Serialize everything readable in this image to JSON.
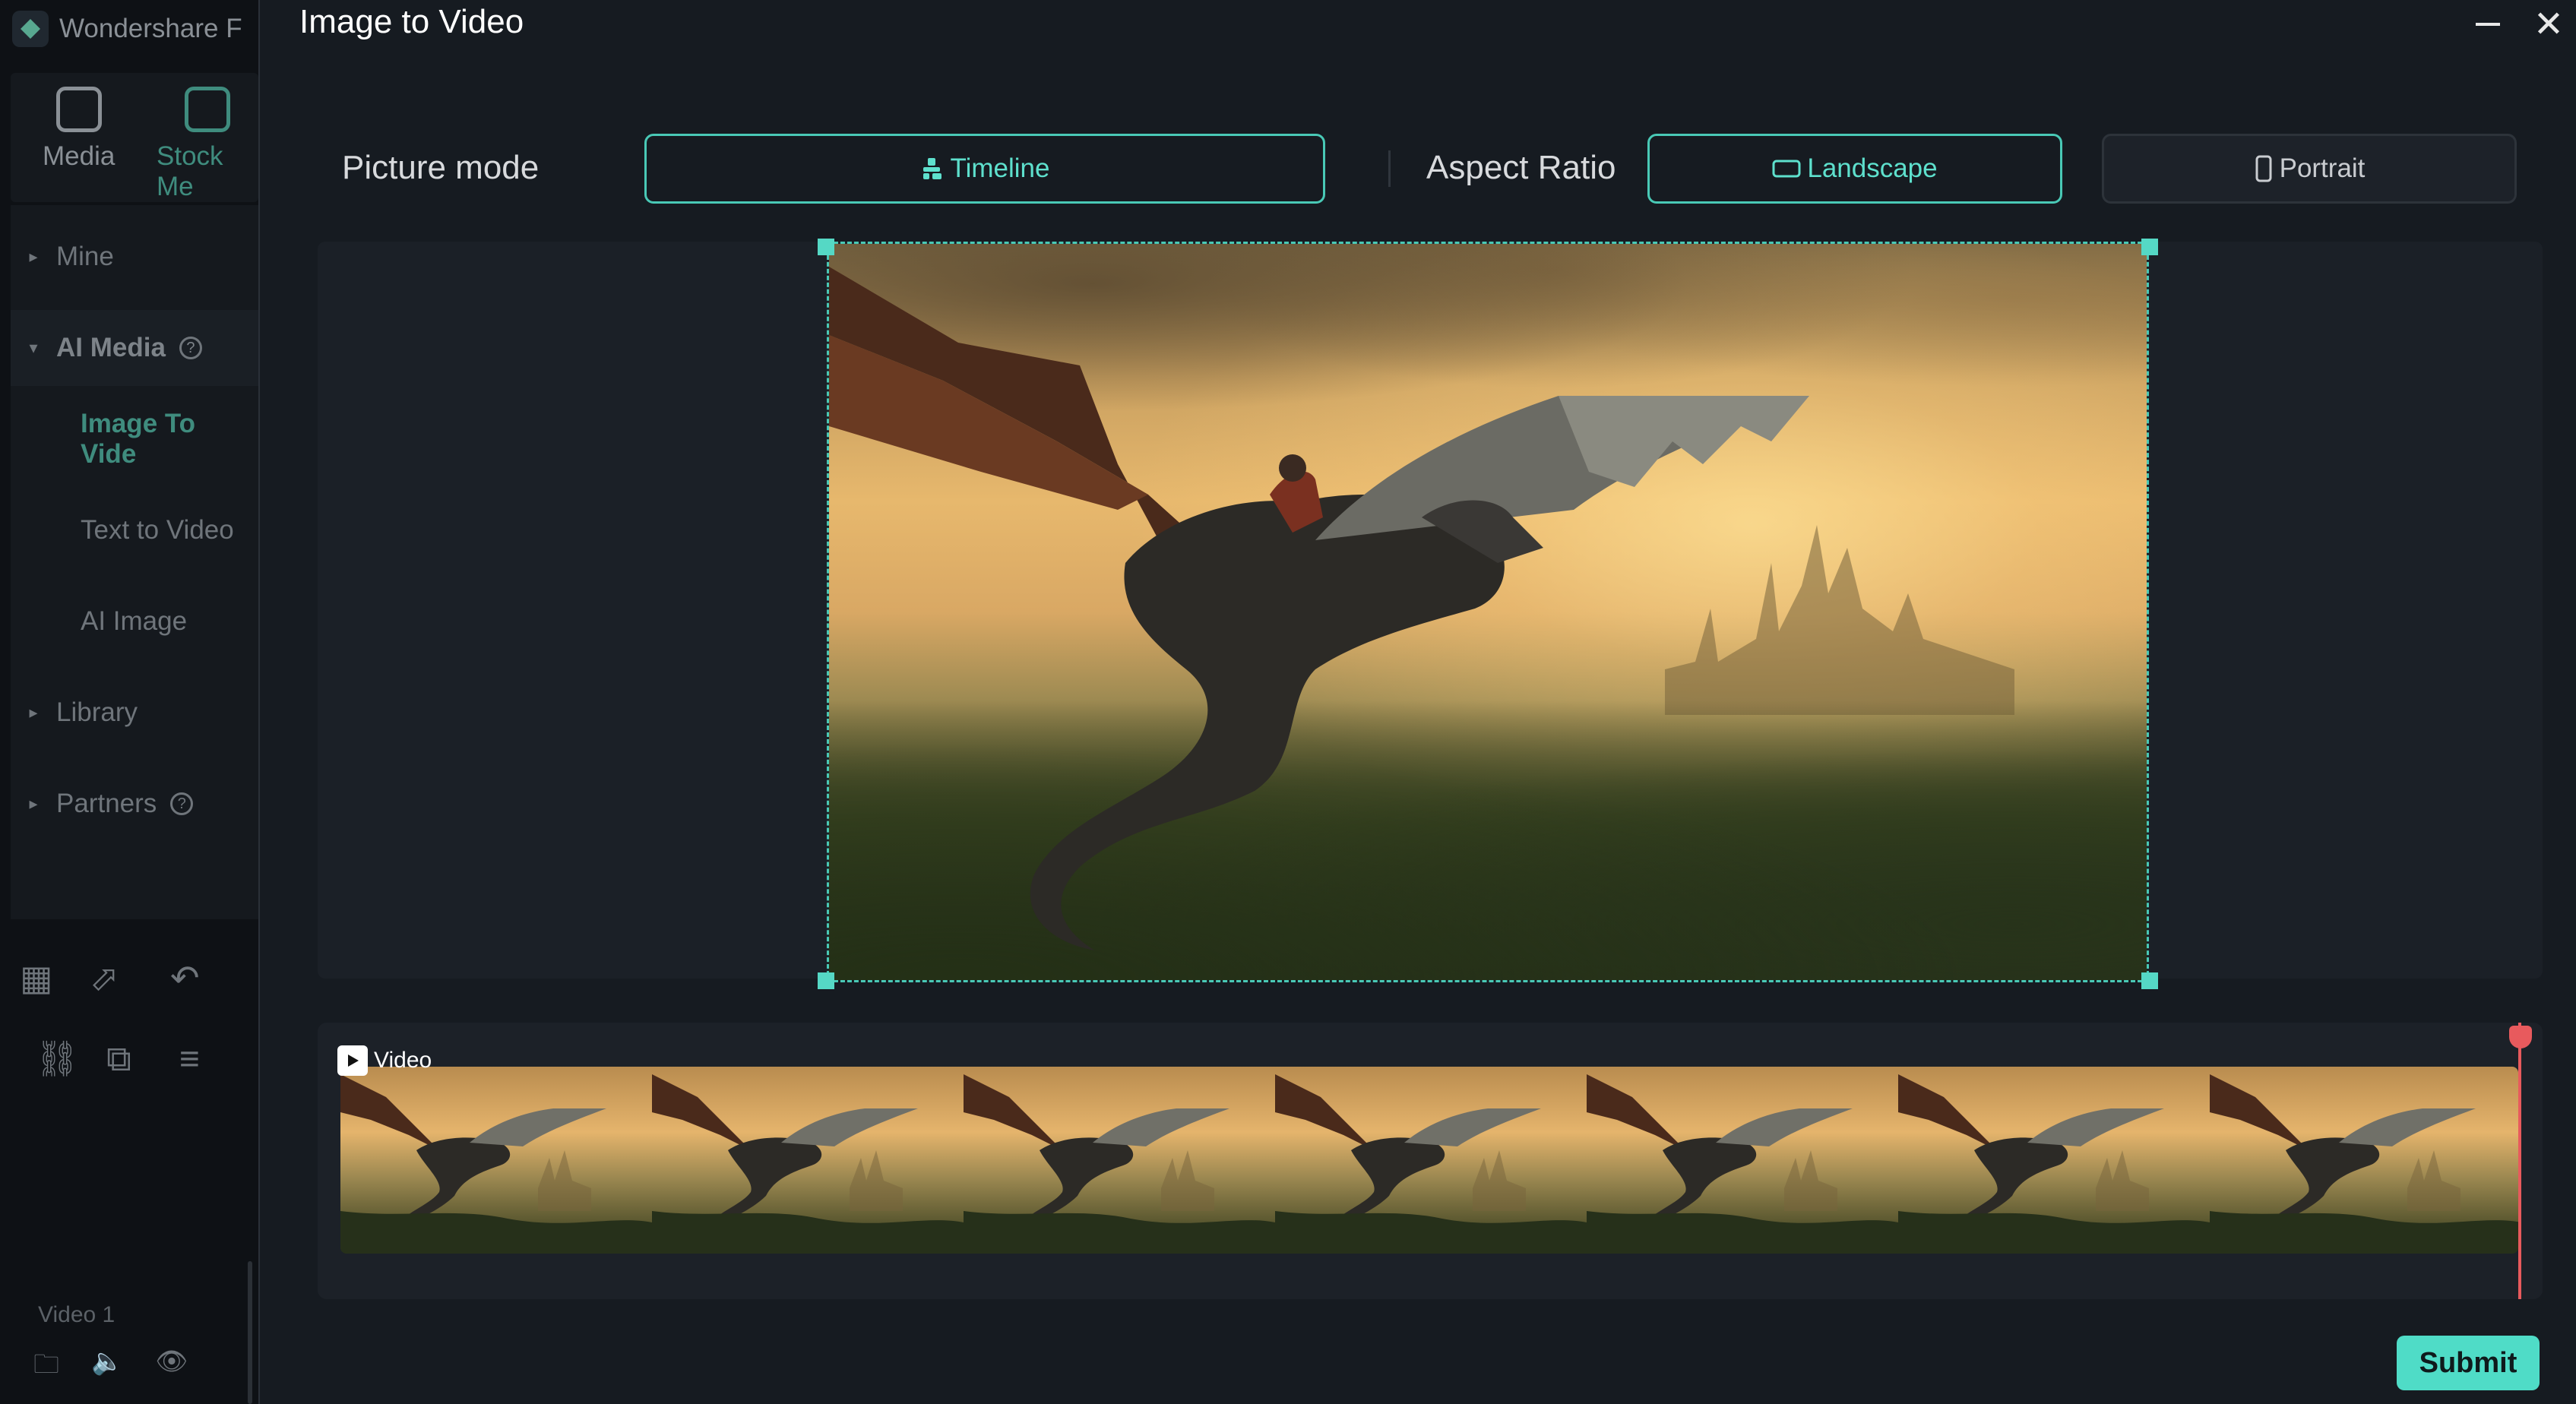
{
  "app": {
    "brand": "Wondershare F",
    "tabs": [
      {
        "label": "Media"
      },
      {
        "label": "Stock Me"
      }
    ],
    "nav": [
      {
        "label": "Mine"
      },
      {
        "label": "AI Media"
      },
      {
        "label": "Image To Vide"
      },
      {
        "label": "Text to Video"
      },
      {
        "label": "AI Image"
      },
      {
        "label": "Library"
      },
      {
        "label": "Partners"
      }
    ],
    "track": {
      "label": "Video 1"
    }
  },
  "modal": {
    "title": "Image to Video",
    "picture_mode": {
      "label": "Picture mode",
      "option": "Timeline"
    },
    "aspect_ratio": {
      "label": "Aspect Ratio",
      "options": [
        "Landscape",
        "Portrait"
      ],
      "selected": "Landscape"
    },
    "timeline": {
      "clip_label": "Video",
      "frame_count": 7
    },
    "submit_label": "Submit"
  },
  "colors": {
    "accent": "#4fdcc7",
    "playhead": "#e85a5d",
    "background": "#161b21"
  },
  "icons": [
    "close-icon",
    "minimize-icon",
    "timeline-icon",
    "landscape-icon",
    "portrait-icon",
    "play-icon"
  ]
}
